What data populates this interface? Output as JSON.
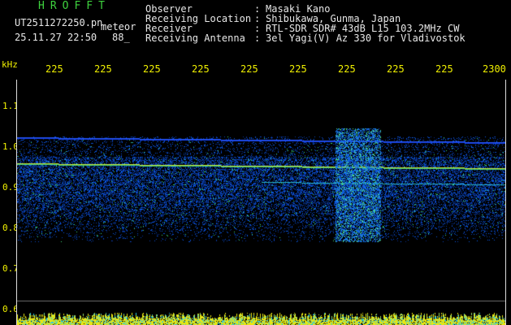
{
  "header": {
    "title": "HROFFT",
    "file_name": "UT2511272250.pn",
    "mode_label": "meteor",
    "datetime": "25.11.27 22:50",
    "level": "88_"
  },
  "info": [
    {
      "label": "Observer",
      "value": "Masaki Kano"
    },
    {
      "label": "Receiving Location",
      "value": "Shibukawa, Gunma, Japan"
    },
    {
      "label": "Receiver",
      "value": "RTL-SDR SDR# 43dB L15 103.2MHz CW"
    },
    {
      "label": "Receiving Antenna",
      "value": "3el Yagi(V) Az 330 for Vladivostok"
    }
  ],
  "axis": {
    "y_unit": "kHz",
    "y_ticks": [
      "1.1",
      "1.0",
      "0.9",
      "0.8",
      "0.7",
      "0.6"
    ],
    "x_ticks": [
      "225",
      "225",
      "225",
      "225",
      "225",
      "225",
      "225",
      "225",
      "225",
      "2300"
    ]
  },
  "colors": {
    "text_green": "#3ed23e",
    "text_white": "#e8e8e8",
    "axis_yellow": "#f0f000",
    "noise_blue": "#1a3cff"
  }
}
